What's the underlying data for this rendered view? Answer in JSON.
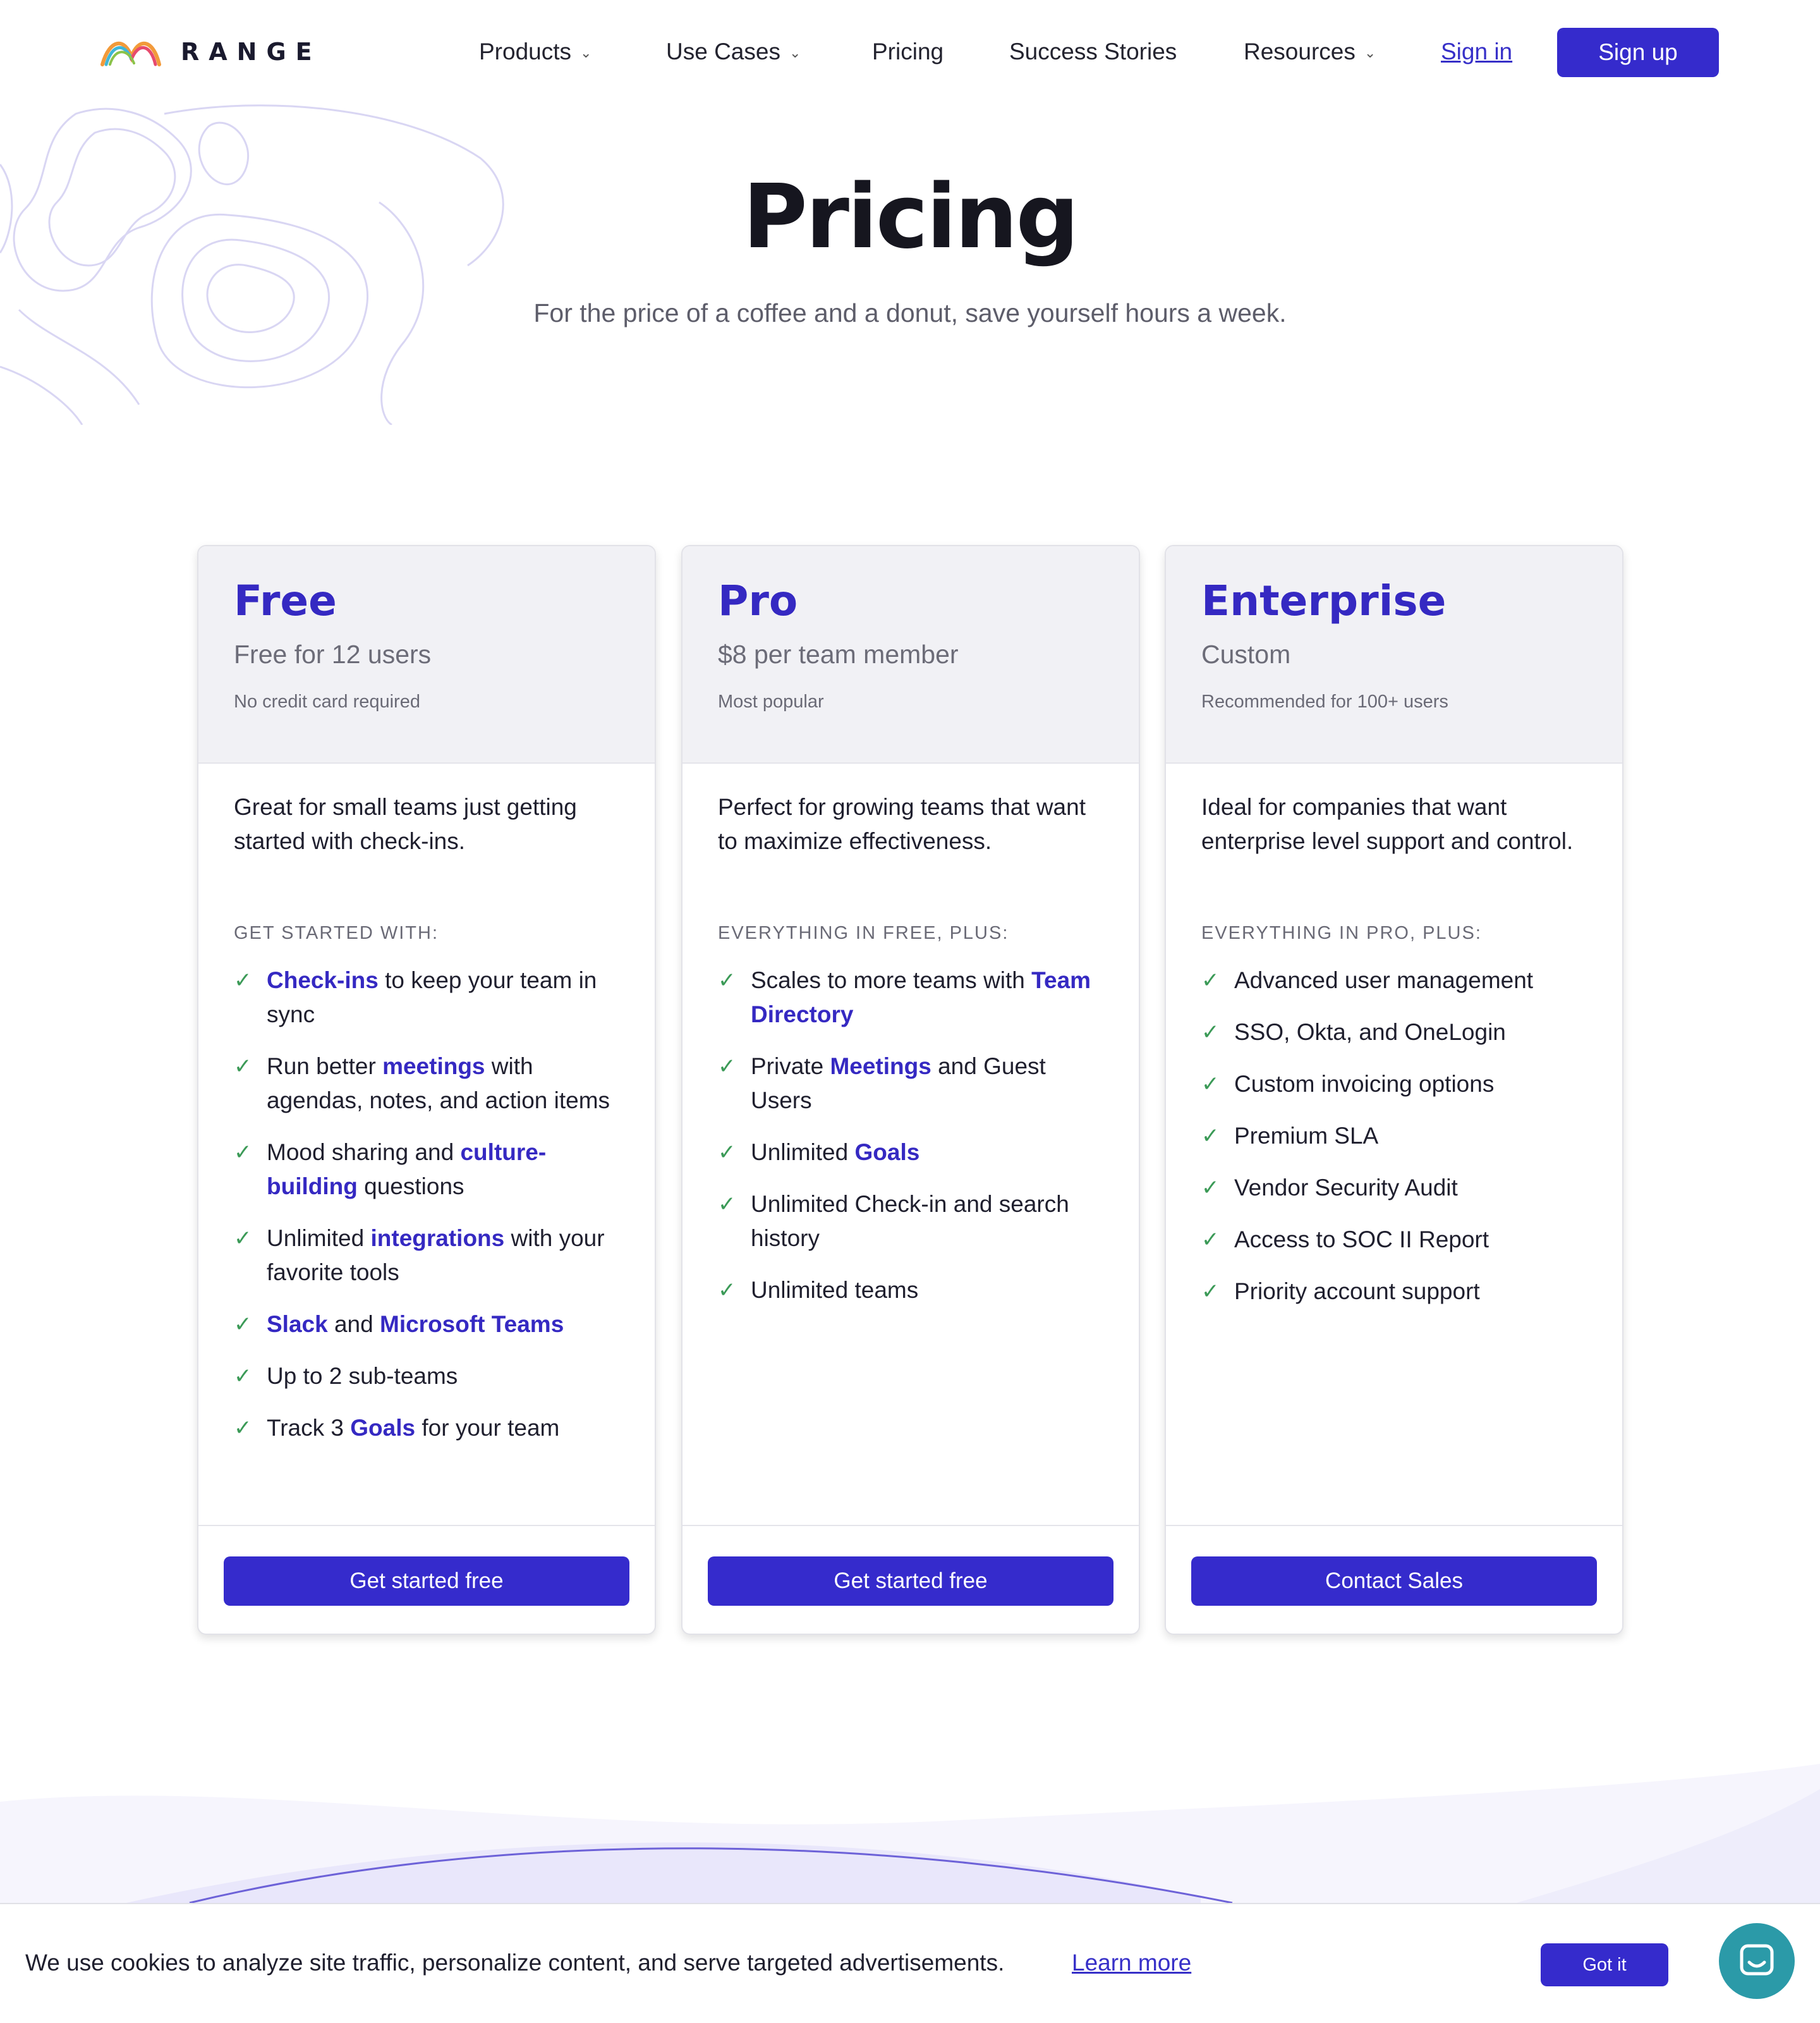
{
  "brand": {
    "name": "RANGE"
  },
  "nav": {
    "items": [
      {
        "label": "Products",
        "dropdown": true
      },
      {
        "label": "Use Cases",
        "dropdown": true
      },
      {
        "label": "Pricing",
        "dropdown": false
      },
      {
        "label": "Success Stories",
        "dropdown": false
      },
      {
        "label": "Resources",
        "dropdown": true
      }
    ],
    "sign_in": "Sign in",
    "sign_up": "Sign up"
  },
  "hero": {
    "title": "Pricing",
    "subtitle": "For the price of a coffee and a donut, save yourself hours a week."
  },
  "plans": [
    {
      "name": "Free",
      "price": "Free for 12 users",
      "note": "No credit card required",
      "description": "Great for small teams just getting started with check-ins.",
      "kicker": "GET STARTED WITH:",
      "features": [
        [
          {
            "t": "Check-ins",
            "h": true
          },
          {
            "t": " to keep your team in sync"
          }
        ],
        [
          {
            "t": "Run better "
          },
          {
            "t": "meetings",
            "h": true
          },
          {
            "t": " with agendas, notes, and action items"
          }
        ],
        [
          {
            "t": "Mood sharing and "
          },
          {
            "t": "culture-building",
            "h": true
          },
          {
            "t": " questions"
          }
        ],
        [
          {
            "t": "Unlimited "
          },
          {
            "t": "integrations",
            "h": true
          },
          {
            "t": " with your favorite tools"
          }
        ],
        [
          {
            "t": "Slack",
            "h": true
          },
          {
            "t": " and "
          },
          {
            "t": "Microsoft Teams",
            "h": true
          }
        ],
        [
          {
            "t": "Up to 2 sub-teams"
          }
        ],
        [
          {
            "t": "Track 3 "
          },
          {
            "t": "Goals",
            "h": true
          },
          {
            "t": " for your team"
          }
        ]
      ],
      "cta": "Get started free"
    },
    {
      "name": "Pro",
      "price": "$8 per team member",
      "note": "Most popular",
      "description": "Perfect for growing teams that want to maximize effectiveness.",
      "kicker": "EVERYTHING IN FREE, PLUS:",
      "features": [
        [
          {
            "t": "Scales to more teams with "
          },
          {
            "t": "Team Directory",
            "h": true
          }
        ],
        [
          {
            "t": "Private "
          },
          {
            "t": "Meetings",
            "h": true
          },
          {
            "t": " and Guest Users"
          }
        ],
        [
          {
            "t": "Unlimited "
          },
          {
            "t": "Goals",
            "h": true
          }
        ],
        [
          {
            "t": "Unlimited Check-in and search history"
          }
        ],
        [
          {
            "t": "Unlimited teams"
          }
        ]
      ],
      "cta": "Get started free"
    },
    {
      "name": "Enterprise",
      "price": "Custom",
      "note": "Recommended for 100+ users",
      "description": "Ideal for companies that want enterprise level support and control.",
      "kicker": "EVERYTHING IN PRO, PLUS:",
      "features": [
        [
          {
            "t": "Advanced user management"
          }
        ],
        [
          {
            "t": "SSO, Okta, and OneLogin"
          }
        ],
        [
          {
            "t": "Custom invoicing options"
          }
        ],
        [
          {
            "t": "Premium SLA"
          }
        ],
        [
          {
            "t": "Vendor Security Audit"
          }
        ],
        [
          {
            "t": "Access to SOC II Report"
          }
        ],
        [
          {
            "t": "Priority account support"
          }
        ]
      ],
      "cta": "Contact Sales"
    }
  ],
  "cookie": {
    "text": "We use cookies to analyze site traffic, personalize content, and serve targeted advertisements.",
    "link": "Learn more",
    "button": "Got it"
  },
  "icons": {
    "check": "checkmark-icon",
    "chevron": "chevron-down-icon",
    "chat": "chat-bubble-icon",
    "logo": "rainbow-arcs-logo"
  },
  "colors": {
    "accent": "#352bcc",
    "check": "#3b9a57",
    "chat": "#2b9aa8"
  }
}
